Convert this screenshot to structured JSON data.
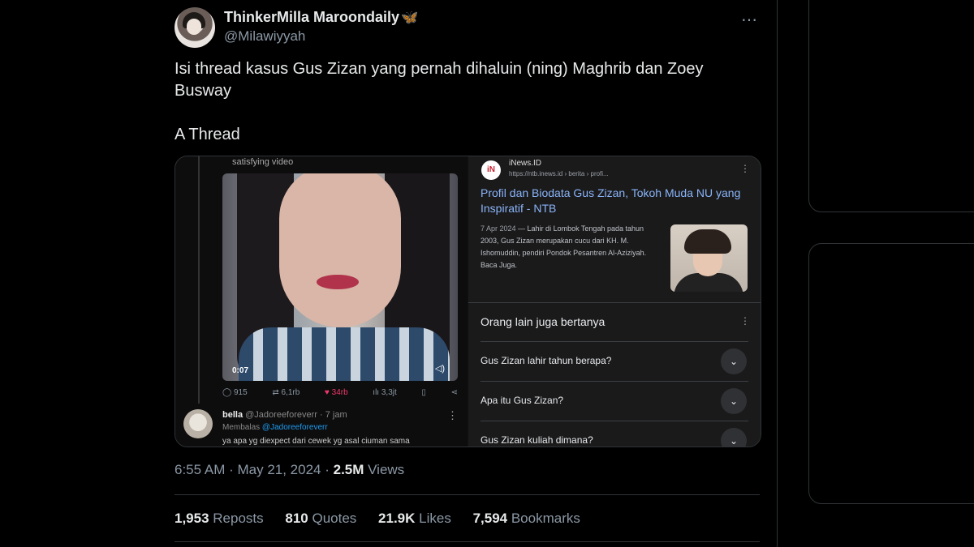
{
  "author": {
    "name": "ThinkerMilla Maroondaily",
    "name_emoji": "🦋",
    "handle": "@Milawiyyah"
  },
  "tweet": {
    "text": "Isi thread kasus Gus Zizan yang pernah dihaluin (ning) Maghrib dan Zoey Busway\n\nA Thread",
    "more_icon": "⋯"
  },
  "media_left": {
    "caption": "satisfying video",
    "video_time": "0:07",
    "actions": {
      "replies": "915",
      "reposts": "6,1rb",
      "likes": "34rb",
      "views": "3,3jt"
    },
    "reply": {
      "name": "bella",
      "handle_time": "@Jadoreeforeverr · 7 jam",
      "replying_prefix": "Membalas",
      "replying_to": "@Jadoreeforeverr",
      "text": "ya apa yg diexpect dari cewek yg asal ciuman sama"
    }
  },
  "media_right": {
    "source_logo": "iN",
    "source_name": "iNews.ID",
    "source_url": "https://ntb.inews.id › berita › profi...",
    "result_title": "Profil dan Biodata Gus Zizan, Tokoh Muda NU yang Inspiratif - NTB",
    "result_date": "7 Apr 2024",
    "result_snippet": " — Lahir di Lombok Tengah pada tahun 2003, Gus Zizan merupakan cucu dari KH. M. Ishomuddin, pendiri Pondok Pesantren Al-Aziziyah. Baca Juga.",
    "paa_title": "Orang lain juga bertanya",
    "questions": [
      "Gus Zizan lahir tahun berapa?",
      "Apa itu Gus Zizan?",
      "Gus Zizan kuliah dimana?"
    ]
  },
  "meta": {
    "time": "6:55 AM · May 21, 2024 · ",
    "views_count": "2.5M",
    "views_label": " Views"
  },
  "stats": {
    "reposts_count": "1,953",
    "reposts_label": " Reposts",
    "quotes_count": "810",
    "quotes_label": " Quotes",
    "likes_count": "21.9K",
    "likes_label": " Likes",
    "bookmarks_count": "7,594",
    "bookmarks_label": " Bookmarks"
  },
  "colors": {
    "background": "#000000",
    "accent": "#1d9bf0",
    "link": "#8ab4f8",
    "like": "#f0386b"
  }
}
